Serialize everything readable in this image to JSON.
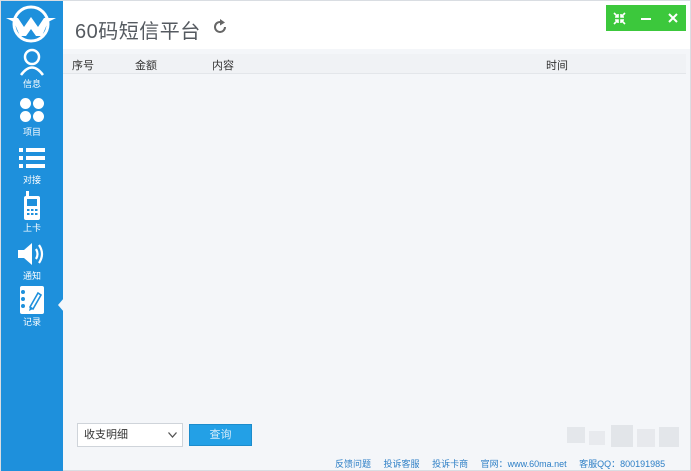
{
  "app": {
    "title": "60码短信平台",
    "brand_color": "#1e90dc",
    "control_color": "#3cc83c"
  },
  "sidebar": {
    "items": [
      {
        "label": "信息",
        "icon": "user-icon"
      },
      {
        "label": "项目",
        "icon": "grid-icon"
      },
      {
        "label": "对接",
        "icon": "list-icon"
      },
      {
        "label": "上卡",
        "icon": "phone-icon"
      },
      {
        "label": "通知",
        "icon": "speaker-icon"
      },
      {
        "label": "记录",
        "icon": "notebook-icon",
        "active": true
      }
    ]
  },
  "table": {
    "columns": [
      "序号",
      "金额",
      "内容",
      "时间"
    ],
    "rows": []
  },
  "controls": {
    "filter_selected": "收支明细",
    "query_label": "查询"
  },
  "footer": {
    "links": [
      "反馈问题",
      "投诉客服",
      "投诉卡商",
      "官网：www.60ma.net",
      "客服QQ：800191985"
    ]
  }
}
